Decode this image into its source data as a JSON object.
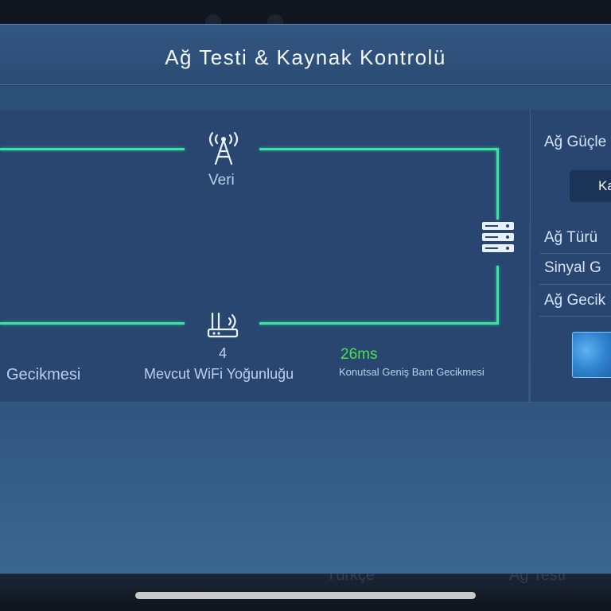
{
  "dialog": {
    "title": "Ağ Testi & Kaynak Kontrolü"
  },
  "network_diagram": {
    "data_node_label": "Veri",
    "wifi_count": "4",
    "wifi_label": "Mevcut WiFi Yoğunluğu",
    "left_latency_label": "Gecikmesi",
    "broadband_latency_value": "26ms",
    "broadband_latency_label": "Konutsal Geniş Bant Gecikmesi",
    "line_color": "#38e6a2",
    "latency_value_color": "#4ee04a"
  },
  "side_panel": {
    "header": "Ağ Güçle",
    "button_label": "Ka",
    "rows": [
      "Ağ Türü",
      "Sinyal G",
      "Ağ Gecik"
    ]
  },
  "background": {
    "tab_left": "Türkçe",
    "tab_right": "Ağ Testi"
  },
  "icons": {
    "tower": "signal-tower-icon",
    "router": "wifi-router-icon",
    "server": "server-icon"
  }
}
